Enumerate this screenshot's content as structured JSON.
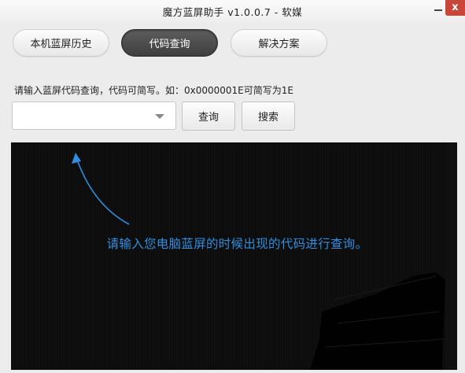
{
  "window": {
    "title": "魔方蓝屏助手 v1.0.0.7 - 软媒",
    "close_glyph": "x"
  },
  "tabs": [
    {
      "label": "本机蓝屏历史",
      "active": false
    },
    {
      "label": "代码查询",
      "active": true
    },
    {
      "label": "解决方案",
      "active": false
    }
  ],
  "query": {
    "hint": "请输入蓝屏代码查询，代码可简写。如：0x0000001E可简写为1E",
    "input_value": "",
    "query_button": "查询",
    "search_button": "搜索"
  },
  "panel": {
    "message": "请输入您电脑蓝屏的时候出现的代码进行查询。"
  },
  "colors": {
    "accent_blue": "#2e8fe0",
    "close_red": "#c9473a",
    "panel_bg": "#0c0c0c"
  }
}
